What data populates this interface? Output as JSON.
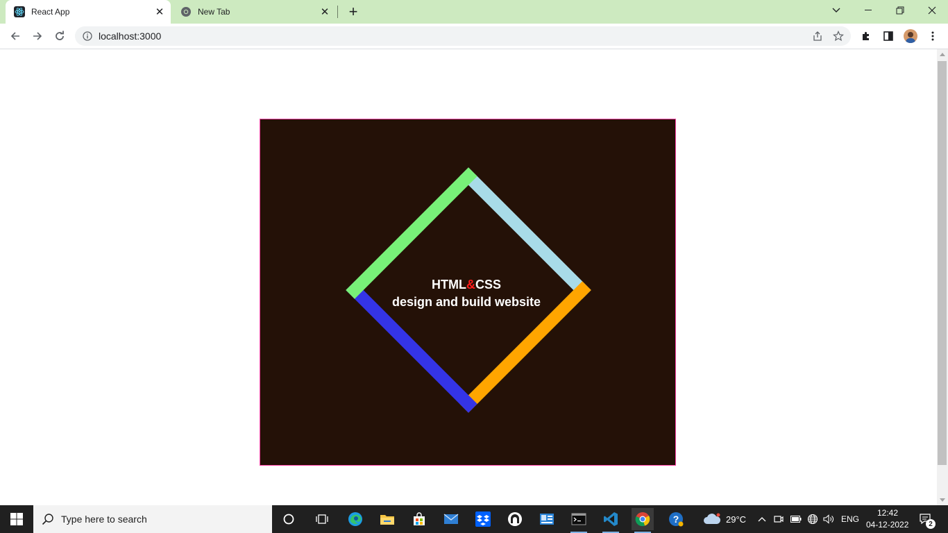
{
  "browser": {
    "tabs": [
      {
        "title": "React App",
        "active": true
      },
      {
        "title": "New Tab",
        "active": false
      }
    ],
    "url": "localhost:3000"
  },
  "page": {
    "heading_part1": "HTML",
    "heading_amp": "&",
    "heading_part2": "CSS",
    "subtitle": "design and build website",
    "colors": {
      "card_bg": "#241107",
      "card_border": "#ff3fa4",
      "edge_top_left": "#a8dbe8",
      "edge_top_right": "#ffa500",
      "edge_bottom_right": "#3434e6",
      "edge_bottom_left": "#78f078",
      "ampersand": "#ff1a1a"
    }
  },
  "taskbar": {
    "search_placeholder": "Type here to search",
    "weather": "29°C",
    "language": "ENG",
    "time": "12:42",
    "date": "04-12-2022",
    "notification_count": "2"
  }
}
